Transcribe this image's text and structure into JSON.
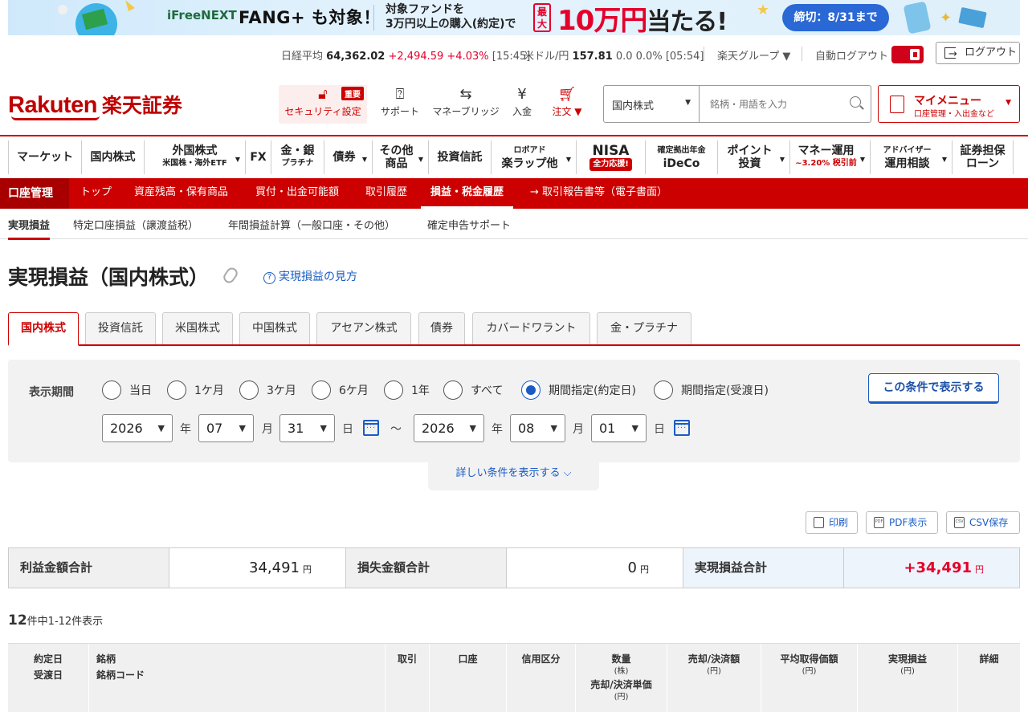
{
  "banner": {
    "ifree": "iFreeNEXT",
    "fang": "FANG+ も対象！",
    "target_line1": "対象ファンドを",
    "target_line2": "3万円以上の購入(約定)で",
    "max_label": "最大",
    "prize": "10万円",
    "prize_suffix": "当たる!",
    "deadline": "締切：8/31まで"
  },
  "ticker": {
    "nikkei_label": "日経平均",
    "nikkei_value": "64,362.02",
    "nikkei_change": "+2,494.59 +4.03%",
    "nikkei_time": "[15:45]",
    "usdjpy_label": "米ドル/円",
    "usdjpy_value": "157.81",
    "usdjpy_change": "0.0 0.0%",
    "usdjpy_time": "[05:54]",
    "group": "楽天グループ ▼",
    "autologout": "自動ログアウト",
    "logout": "ログアウト"
  },
  "header": {
    "logo": "Rakuten",
    "logo_jp": "楽天証券",
    "security": "セキュリティ設定",
    "security_badge": "重要",
    "support": "サポート",
    "moneybridge": "マネーブリッジ",
    "deposit": "入金",
    "order": "注文 ▼",
    "search_select": "国内株式",
    "search_placeholder": "銘柄・用語を入力",
    "mymenu_title": "マイメニュー",
    "mymenu_sub": "口座管理・入出金など"
  },
  "gnav": [
    {
      "main": "マーケット",
      "sub": ""
    },
    {
      "main": "国内株式",
      "sub": ""
    },
    {
      "main": "外国株式",
      "sub": "米国株・海外ETF"
    },
    {
      "main": "FX",
      "sub": ""
    },
    {
      "main": "金・銀",
      "sub": "プラチナ"
    },
    {
      "main": "債券",
      "sub": ""
    },
    {
      "main": "その他",
      "sub": "商品"
    },
    {
      "main": "投資信託",
      "sub": ""
    },
    {
      "main": "ロボアド",
      "sub": "楽ラップ他"
    },
    {
      "main": "NISA",
      "sub": "全力応援!"
    },
    {
      "main": "確定拠出年金",
      "sub": "iDeCo"
    },
    {
      "main": "ポイント",
      "sub": "投資"
    },
    {
      "main": "マネー運用",
      "sub": "~3.20% 税引前"
    },
    {
      "main": "アドバイザー",
      "sub": "運用相談"
    },
    {
      "main": "証券担保",
      "sub": "ローン"
    }
  ],
  "subnav": {
    "account": "口座管理",
    "items": [
      "トップ",
      "資産残高・保有商品",
      "買付・出金可能額",
      "取引履歴",
      "損益・税金履歴",
      "→ 取引報告書等（電子書面）"
    ]
  },
  "tnav": [
    "実現損益",
    "特定口座損益（譲渡益税）",
    "年間損益計算（一般口座・その他）",
    "確定申告サポート"
  ],
  "page": {
    "title": "実現損益（国内株式）",
    "howto": "実現損益の見方"
  },
  "asset_tabs": [
    "国内株式",
    "投資信託",
    "米国株式",
    "中国株式",
    "アセアン株式",
    "債券",
    "カバードワラント",
    "金・プラチナ"
  ],
  "filter": {
    "label": "表示期間",
    "options": [
      "当日",
      "1ケ月",
      "3ケ月",
      "6ケ月",
      "1年",
      "すべて",
      "期間指定(約定日)",
      "期間指定(受渡日)"
    ],
    "selected": "期間指定(約定日)",
    "show_button": "この条件で表示する",
    "from": {
      "year": "2026",
      "month": "07",
      "day": "31"
    },
    "to": {
      "year": "2026",
      "month": "08",
      "day": "01"
    },
    "year_unit": "年",
    "month_unit": "月",
    "day_unit": "日",
    "tilde": "〜",
    "more": "詳しい条件を表示する ⌵"
  },
  "actions": {
    "print": "印刷",
    "pdf": "PDF表示",
    "csv": "CSV保存"
  },
  "summary": {
    "profit_label": "利益金額合計",
    "profit_value": "34,491",
    "loss_label": "損失金額合計",
    "loss_value": "0",
    "total_label": "実現損益合計",
    "total_value": "+34,491",
    "unit": "円"
  },
  "count": {
    "total": "12",
    "text": "件中1-12件表示"
  },
  "table_headers": {
    "date1": "約定日",
    "date2": "受渡日",
    "name1": "銘柄",
    "name2": "銘柄コード",
    "trade": "取引",
    "account": "口座",
    "margin": "信用区分",
    "qty": "数量",
    "qty_unit": "(株)",
    "price": "売却/決済単価",
    "price_unit": "(円)",
    "amount": "売却/決済額",
    "amount_unit": "(円)",
    "avg": "平均取得価額",
    "avg_unit": "(円)",
    "pl": "実現損益",
    "pl_unit": "(円)",
    "detail": "詳細"
  },
  "colors": {
    "brand": "#bf0000",
    "link": "#1a5cc4",
    "profit": "#e4002b"
  }
}
